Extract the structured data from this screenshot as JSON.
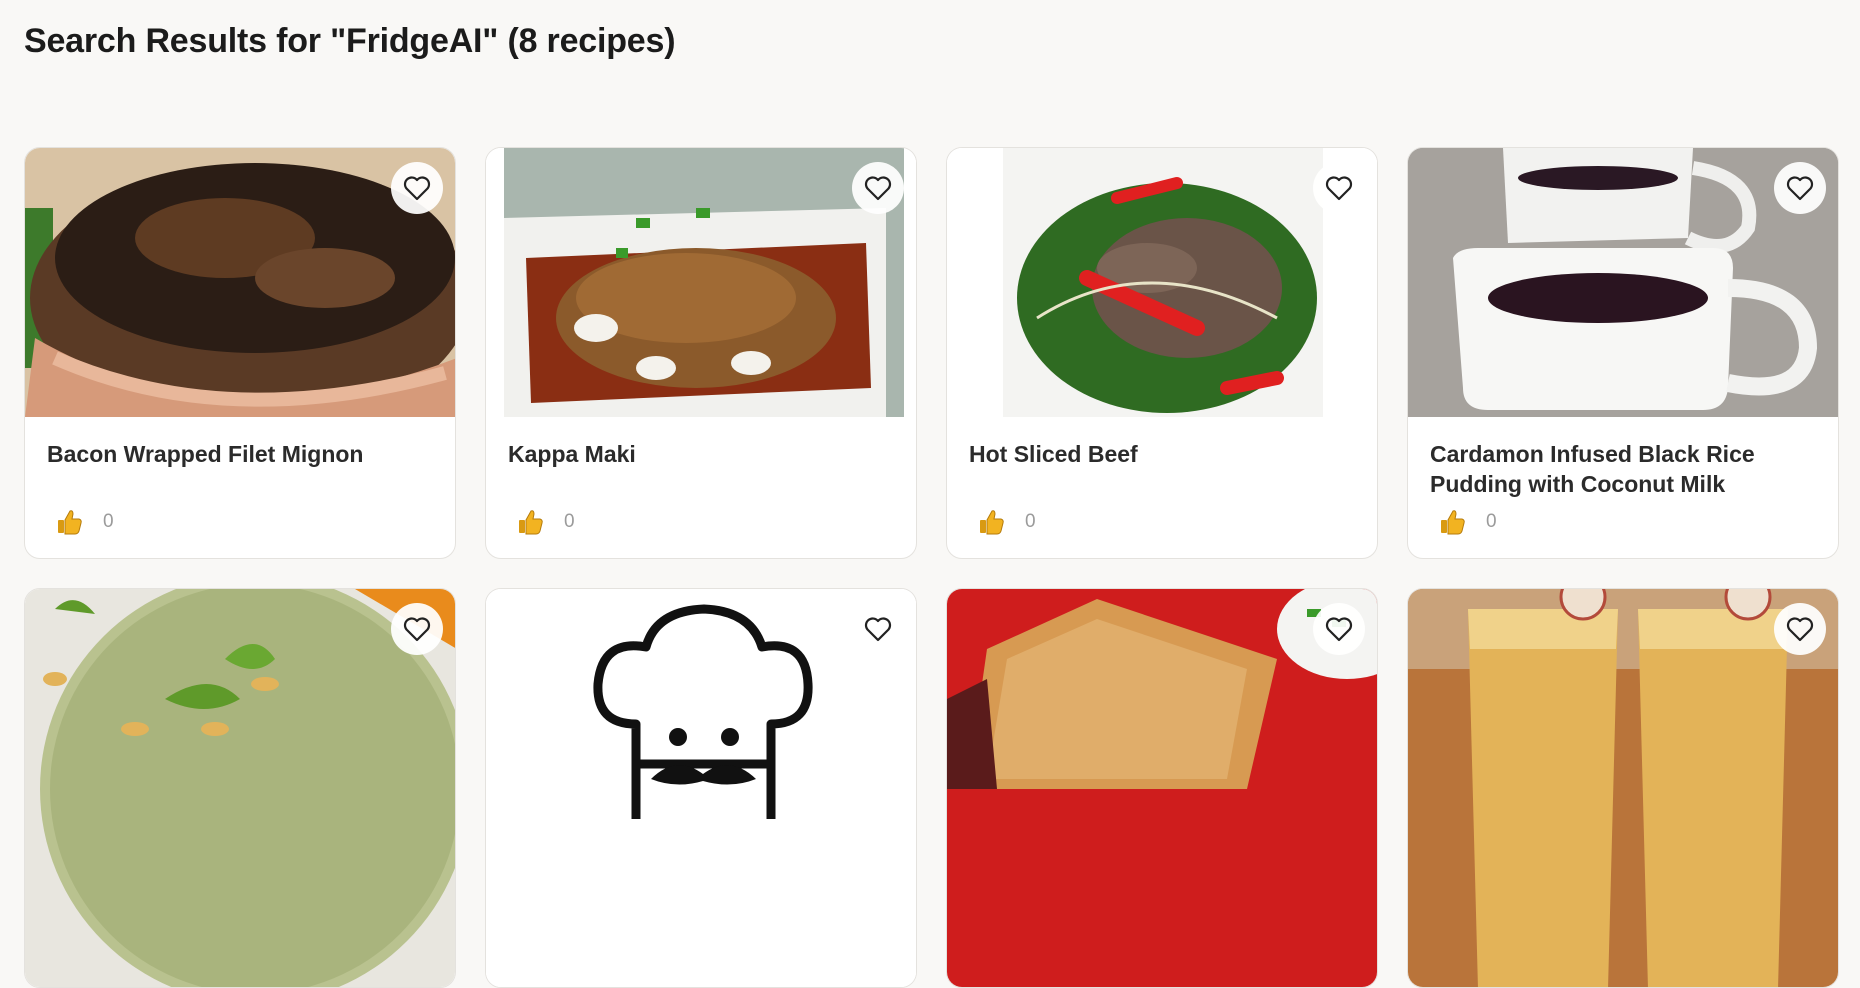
{
  "page": {
    "title": "Search Results for \"FridgeAI\" (8 recipes)"
  },
  "recipes": [
    {
      "name": "Bacon Wrapped Filet Mignon",
      "likes": "0"
    },
    {
      "name": "Kappa Maki",
      "likes": "0"
    },
    {
      "name": "Hot Sliced Beef",
      "likes": "0"
    },
    {
      "name": "Cardamon Infused Black Rice Pudding with Coconut Milk",
      "likes": "0"
    },
    {
      "name": "",
      "likes": ""
    },
    {
      "name": "",
      "likes": ""
    },
    {
      "name": "",
      "likes": ""
    },
    {
      "name": "",
      "likes": ""
    }
  ],
  "icons": {
    "favorite": "heart-outline-icon",
    "like": "thumbs-up-icon",
    "placeholder": "chef-icon"
  },
  "colors": {
    "background": "#f9f8f6",
    "card_border": "#e4e2de",
    "like_count": "#9b9b9b",
    "thumb": "#f2b321"
  }
}
